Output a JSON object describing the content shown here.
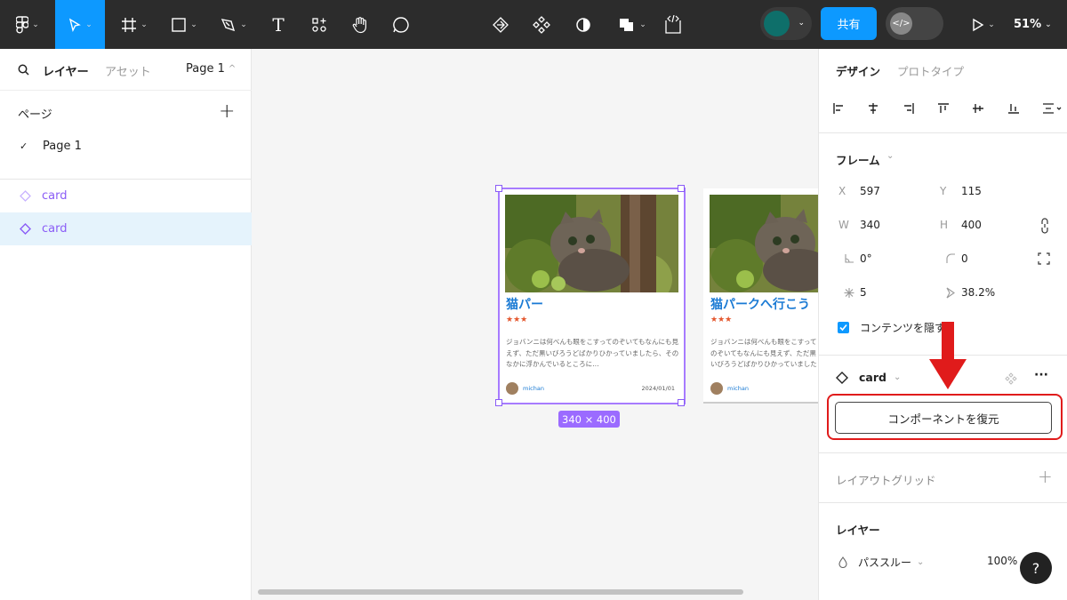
{
  "toolbar": {
    "share_label": "共有",
    "zoom_label": "51%",
    "dev_toggle_label": "</>",
    "chevron": "⌄",
    "text_tool_label": "T"
  },
  "left_panel": {
    "tab_layers": "レイヤー",
    "tab_assets": "アセット",
    "page_selector": "Page 1",
    "page_caret": "^",
    "pages_title": "ページ",
    "add_page": "+",
    "check_mark": "✓",
    "pages": [
      {
        "label": "Page 1"
      }
    ],
    "layers": [
      {
        "label": "card",
        "selected": false
      },
      {
        "label": "card",
        "selected": true
      }
    ]
  },
  "canvas": {
    "cards": [
      {
        "title": "猫パー",
        "stars": "★★★",
        "description": "ジョバンニは何べんも眼をこすってのぞいてもなんにも見えず、ただ黒いびろうどばかりひかっていましたら、そのなかに浮かんでいるところに…",
        "author": "michan",
        "date": "2024/01/01"
      },
      {
        "title": "猫パークへ行こう",
        "stars": "★★★",
        "description": "ジョバンニは何べんも眼をこすってのぞいてもなんにも見えず、ただ黒いびろうどばかりひかっていましたら、そのなかに浮かんで",
        "author": "michan",
        "date": ""
      }
    ],
    "size_badge": "340 × 400"
  },
  "right_panel": {
    "tab_design": "デザイン",
    "tab_prototype": "プロトタイプ",
    "frame_title": "フレーム",
    "frame_caret": "⌄",
    "props": {
      "x_label": "X",
      "x": "597",
      "y_label": "Y",
      "y": "115",
      "w_label": "W",
      "w": "340",
      "h_label": "H",
      "h": "400",
      "rotation": "0°",
      "radius": "0",
      "count": "5",
      "ratio": "38.2%"
    },
    "clip_content_label": "コンテンツを隠す",
    "component_name": "card",
    "component_caret": "⌄",
    "more_label": "···",
    "restore_button": "コンポーネントを復元",
    "layout_grid_title": "レイアウトグリッド",
    "layout_grid_add": "+",
    "layer_title": "レイヤー",
    "blend_mode": "パススルー",
    "blend_caret": "⌄",
    "opacity": "100%",
    "help": "?"
  },
  "colors": {
    "accent": "#0d99ff",
    "component": "#8a5cf6",
    "highlight": "#e01b1b",
    "title_blue": "#1a7ad4"
  }
}
